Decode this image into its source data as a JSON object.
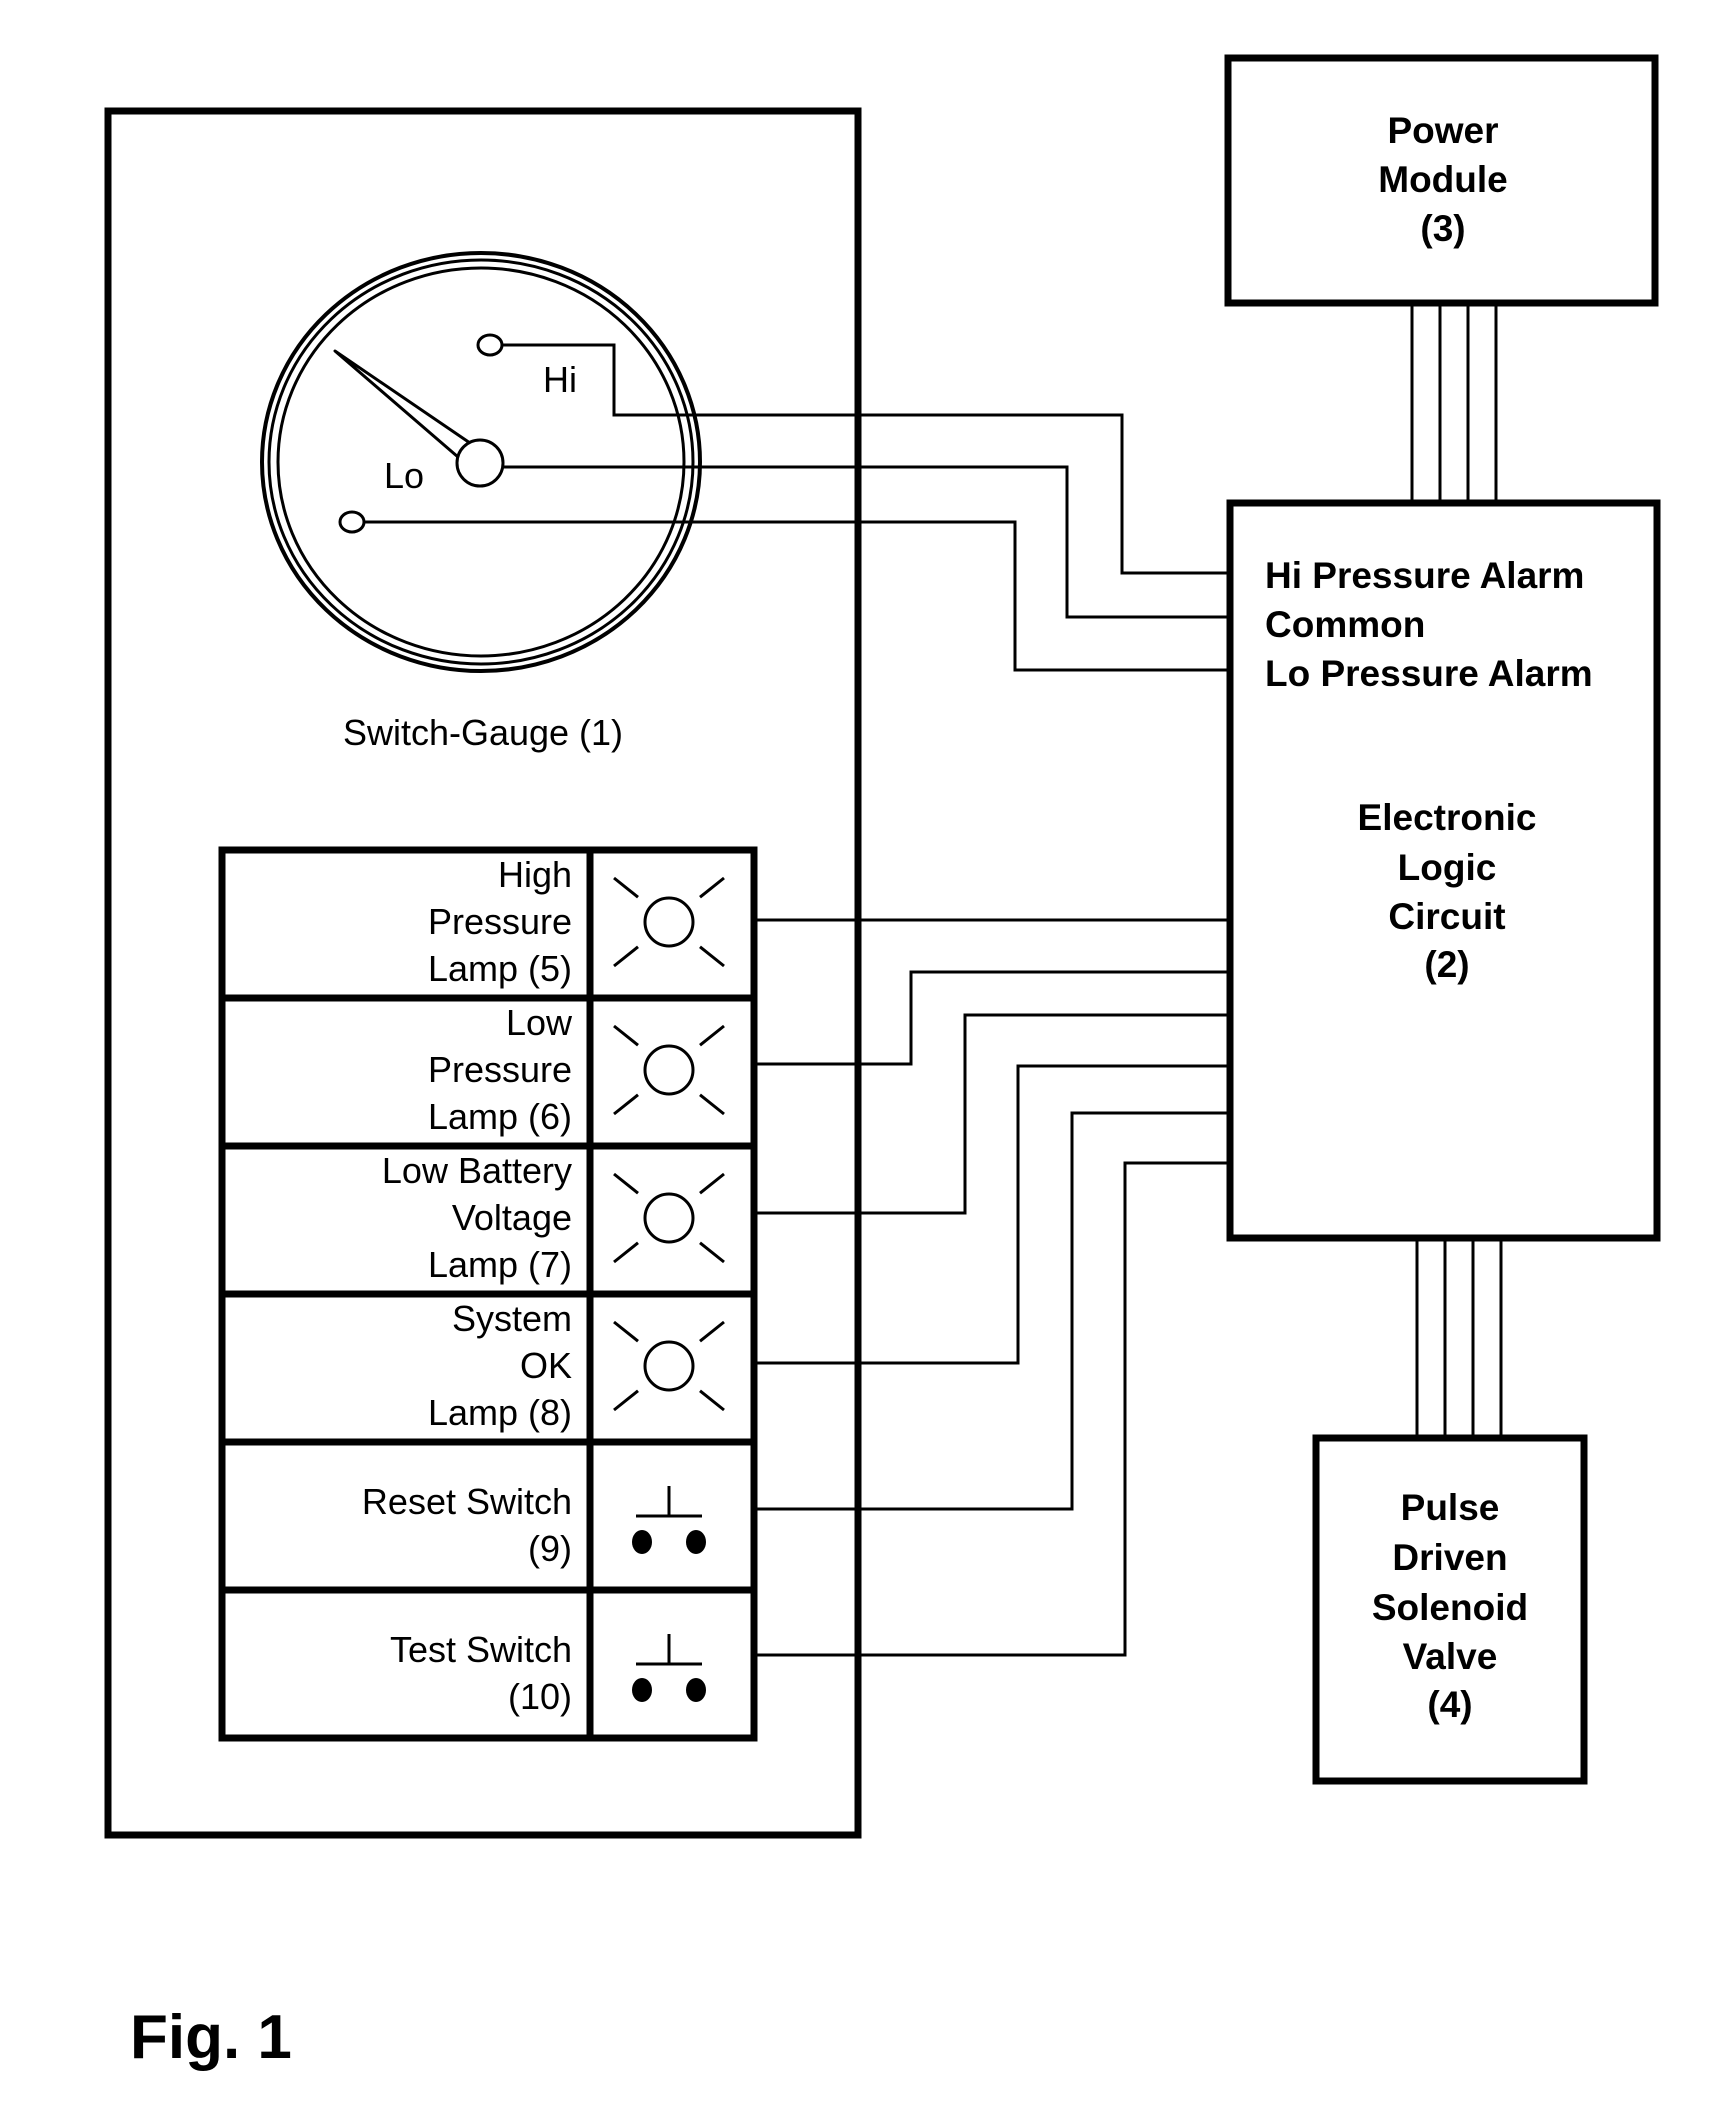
{
  "figure_label": "Fig. 1",
  "switch_gauge": {
    "caption": "Switch-Gauge (1)",
    "hi_label": "Hi",
    "lo_label": "Lo"
  },
  "power_module": {
    "lines": [
      "Power",
      "Module",
      "(3)"
    ]
  },
  "logic_circuit": {
    "terminal_labels": [
      "Hi Pressure Alarm",
      "Common",
      "Lo Pressure Alarm"
    ],
    "title_lines": [
      "Electronic",
      "Logic",
      "Circuit",
      "(2)"
    ]
  },
  "solenoid_valve": {
    "lines": [
      "Pulse",
      "Driven",
      "Solenoid",
      "Valve",
      "(4)"
    ]
  },
  "panel": {
    "rows": [
      {
        "type": "lamp",
        "icon": "lamp-icon",
        "lines": [
          "High",
          "Pressure",
          "Lamp (5)"
        ]
      },
      {
        "type": "lamp",
        "icon": "lamp-icon",
        "lines": [
          "Low",
          "Pressure",
          "Lamp (6)"
        ]
      },
      {
        "type": "lamp",
        "icon": "lamp-icon",
        "lines": [
          "Low Battery",
          "Voltage",
          "Lamp (7)"
        ]
      },
      {
        "type": "lamp",
        "icon": "lamp-icon",
        "lines": [
          "System",
          "OK",
          "Lamp (8)"
        ]
      },
      {
        "type": "switch",
        "icon": "push-button-switch-icon",
        "lines": [
          "Reset Switch",
          "(9)"
        ]
      },
      {
        "type": "switch",
        "icon": "push-button-switch-icon",
        "lines": [
          "Test Switch",
          "(10)"
        ]
      }
    ]
  },
  "bus_wire_count": {
    "power_to_logic": 4,
    "logic_to_valve": 4
  }
}
